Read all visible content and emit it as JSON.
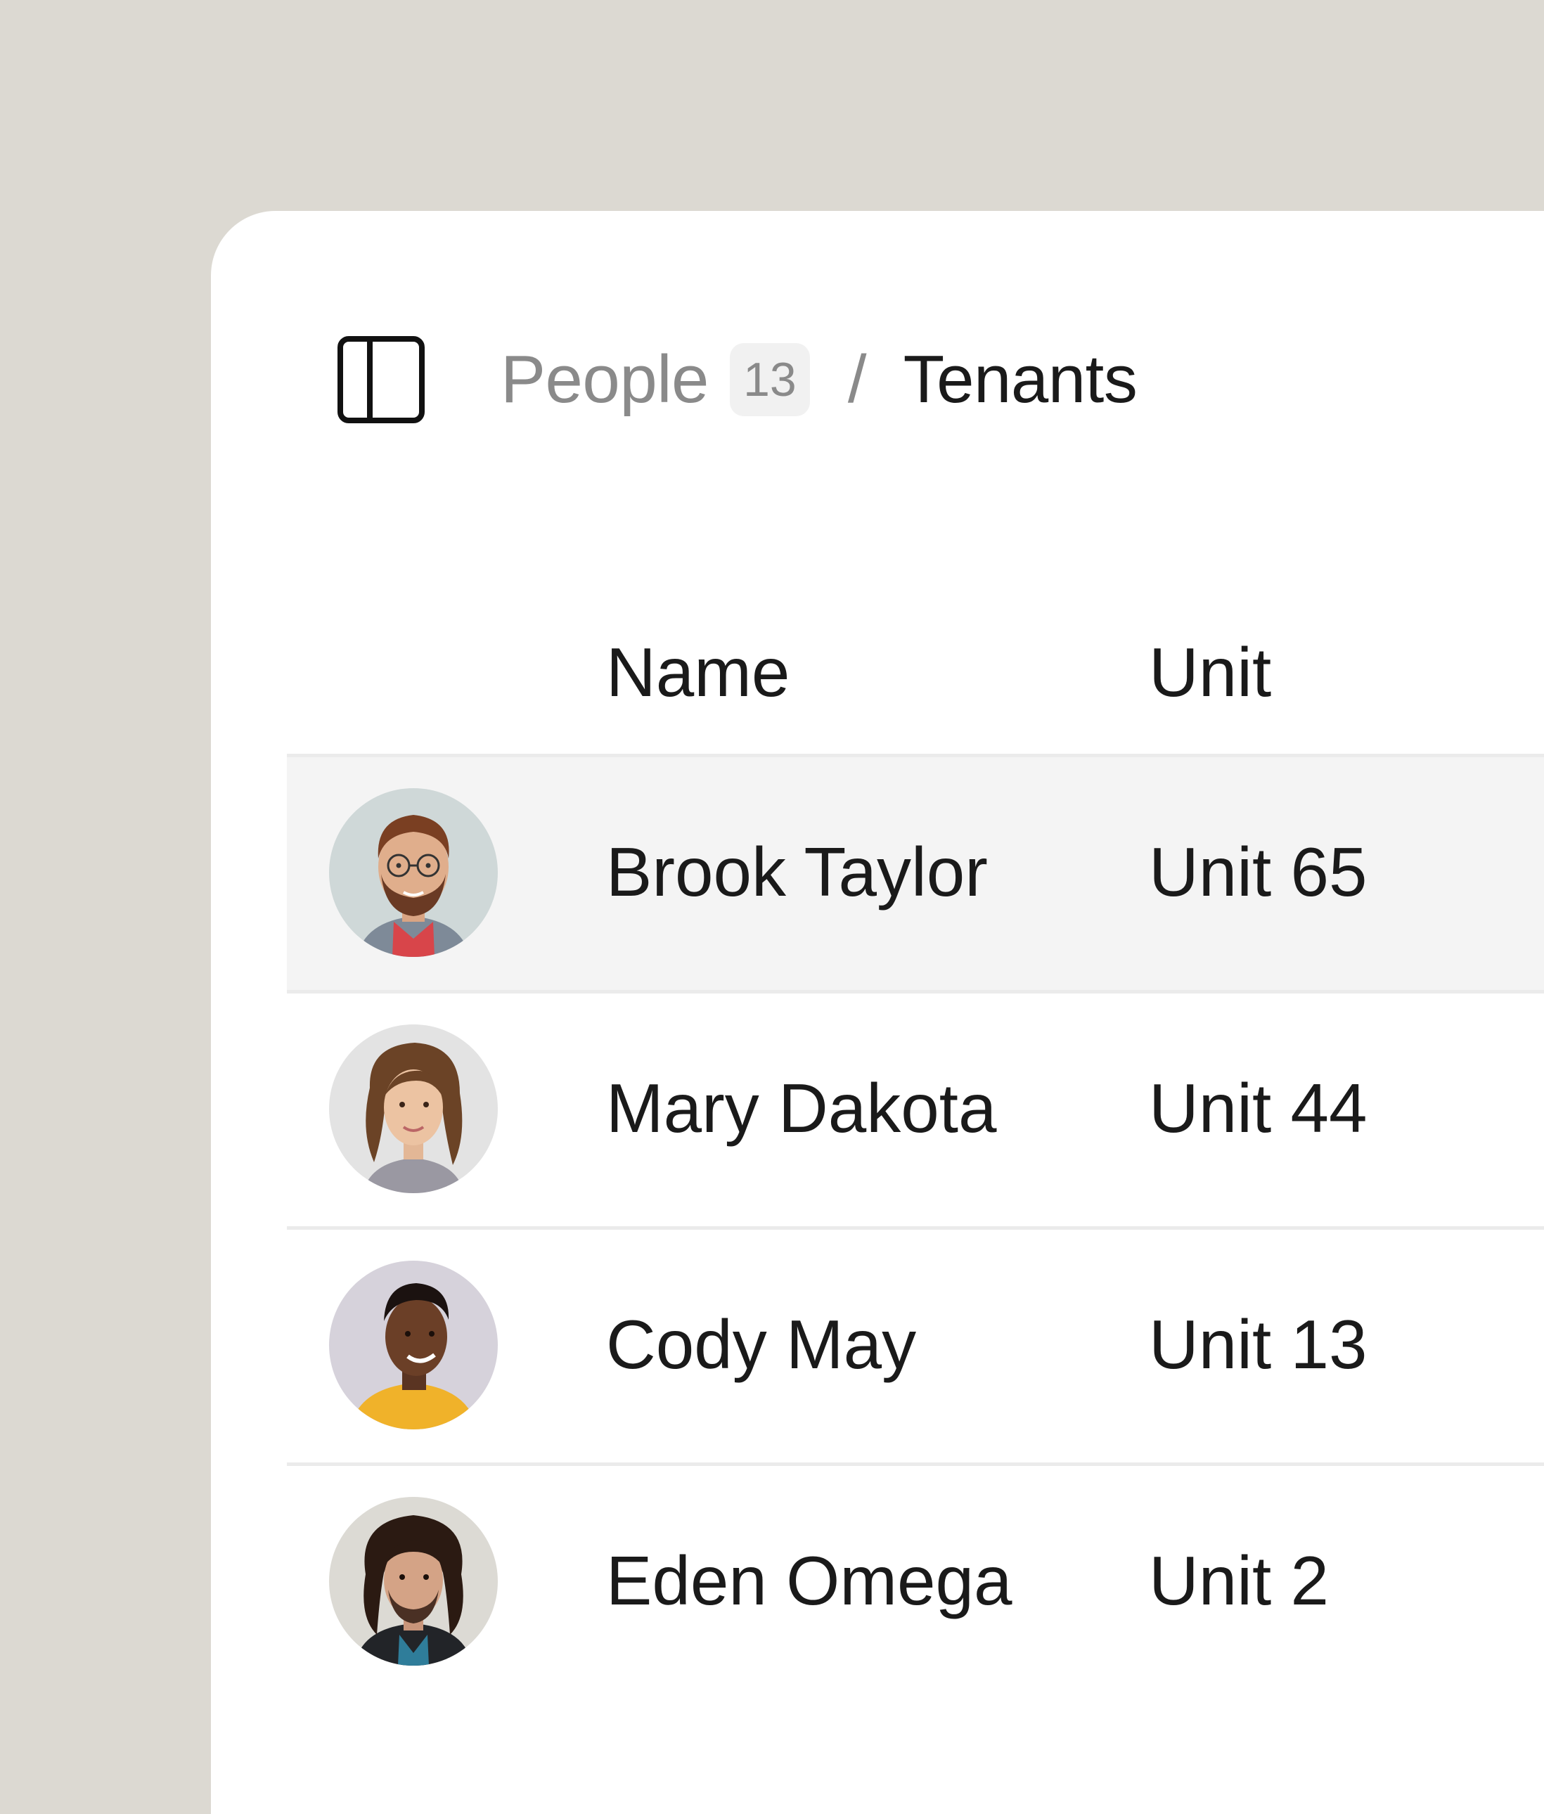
{
  "header": {
    "breadcrumb_parent": "People",
    "parent_count": "13",
    "separator": "/",
    "breadcrumb_current": "Tenants",
    "toggle_icon": "sidebar-panel-icon"
  },
  "table": {
    "columns": [
      "Name",
      "Unit"
    ],
    "rows": [
      {
        "name": "Brook Taylor",
        "unit": "Unit 65",
        "selected": true
      },
      {
        "name": "Mary Dakota",
        "unit": "Unit 44",
        "selected": false
      },
      {
        "name": "Cody May",
        "unit": "Unit 13",
        "selected": false
      },
      {
        "name": "Eden Omega",
        "unit": "Unit 2",
        "selected": false
      }
    ]
  },
  "colors": {
    "background": "#dcd9d2",
    "card": "#ffffff",
    "selected_row": "#f4f4f4",
    "divider": "#ebebeb",
    "muted_text": "#8a8a8a",
    "primary_text": "#1a1a1a"
  }
}
